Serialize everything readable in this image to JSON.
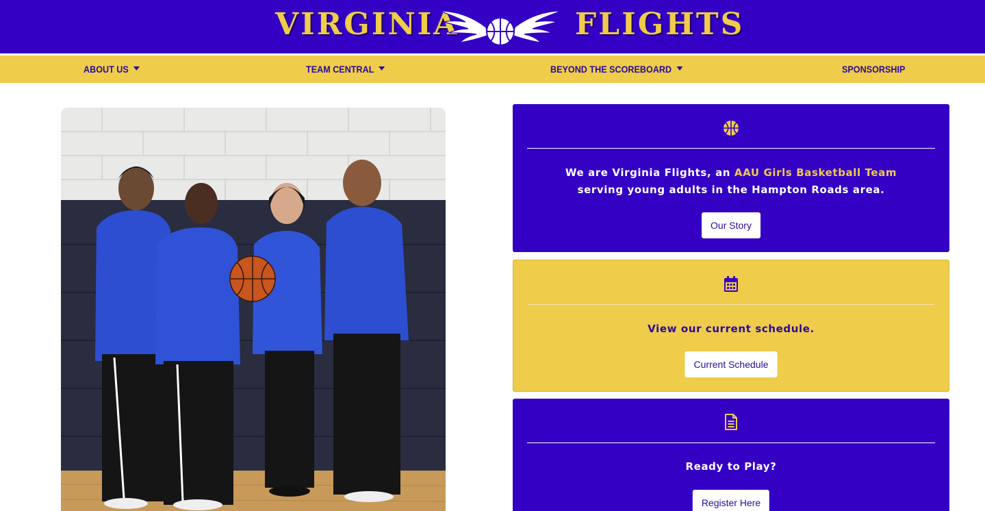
{
  "header": {
    "brand_left": "VIRGINIA",
    "brand_right": "FLIGHTS",
    "logo_icon": "winged-basketball-logo"
  },
  "nav": {
    "items": [
      {
        "label": "ABOUT US",
        "dropdown": true
      },
      {
        "label": "TEAM CENTRAL",
        "dropdown": true
      },
      {
        "label": "BEYOND THE SCOREBOARD",
        "dropdown": true
      },
      {
        "label": "SPONSORSHIP",
        "dropdown": false
      }
    ]
  },
  "cards": [
    {
      "icon": "basketball-icon",
      "text_before": "We are Virginia Flights, an ",
      "text_highlight": "AAU Girls Basketball Team",
      "text_line2": "serving young adults in the Hampton Roads area.",
      "button": "Our Story"
    },
    {
      "icon": "calendar-icon",
      "text": "View our current schedule.",
      "button": "Current Schedule"
    },
    {
      "icon": "document-icon",
      "text": "Ready to Play?",
      "button": "Register Here"
    }
  ],
  "colors": {
    "brand_purple": "#3300c4",
    "brand_gold": "#efcc4a",
    "nav_text": "#2a0a9a"
  }
}
